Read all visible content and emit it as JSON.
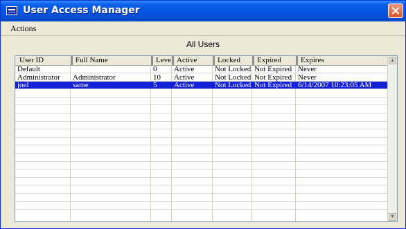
{
  "window": {
    "title": "User Access Manager"
  },
  "menubar": {
    "actions": "Actions"
  },
  "group_label": "All Users",
  "table": {
    "columns": [
      "User ID",
      "Full Name",
      "Level",
      "Active",
      "Locked",
      "Expired",
      "Expires"
    ],
    "rows": [
      [
        "Default",
        "",
        "0",
        "Active",
        "Not Locked",
        "Not Expired",
        "Never"
      ],
      [
        "Administrator",
        "Administrator",
        "10",
        "Active",
        "Not Locked",
        "Not Expired",
        "Never"
      ],
      [
        "joel",
        "same",
        "5",
        "Active",
        "Not Locked",
        "Not Expired",
        "6/14/2007 10:23:05 AM"
      ]
    ],
    "selected_row": 2,
    "empty_rows": 15
  },
  "colors": {
    "title_bar": "#0553e0",
    "selection": "#1421d8"
  },
  "icons": {
    "close": "close-icon",
    "scroll_up": "chevron-up-icon",
    "scroll_down": "chevron-down-icon"
  }
}
